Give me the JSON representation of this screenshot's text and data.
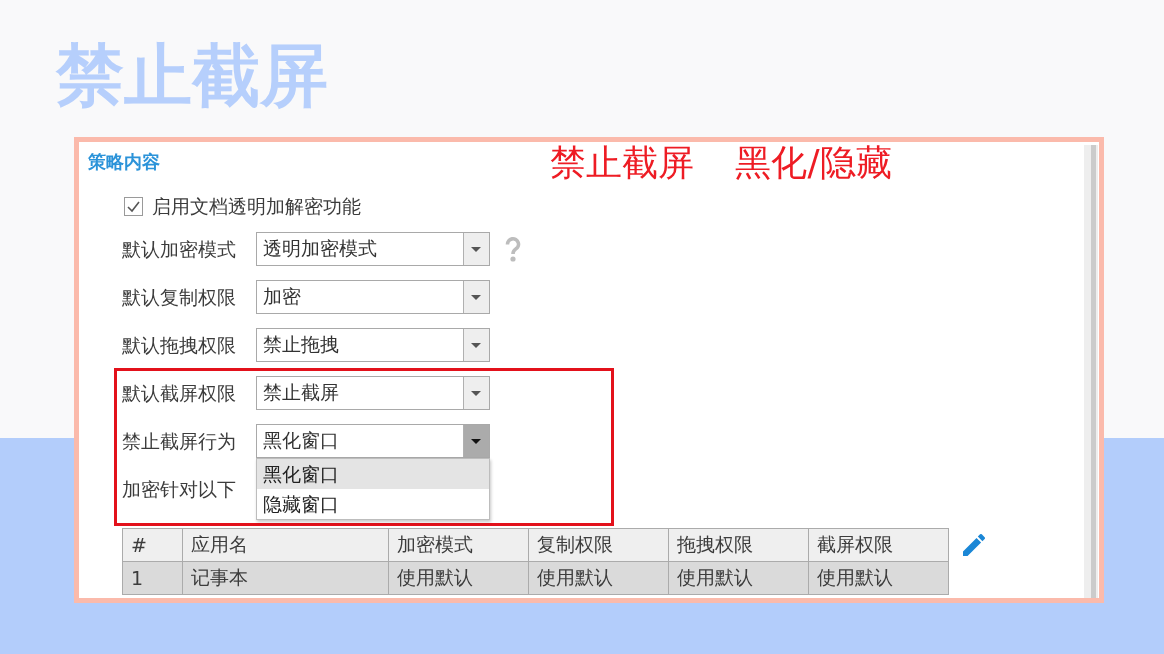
{
  "slide": {
    "title": "禁止截屏"
  },
  "screenshot": {
    "caption": "禁止截屏 黑化/隐藏",
    "section_title": "策略内容",
    "enable_option": {
      "label": "启用文档透明加解密功能",
      "checked": true
    },
    "settings": [
      {
        "label": "默认加密模式",
        "value": "透明加密模式",
        "open": false,
        "help": true
      },
      {
        "label": "默认复制权限",
        "value": "加密",
        "open": false,
        "help": false
      },
      {
        "label": "默认拖拽权限",
        "value": "禁止拖拽",
        "open": false,
        "help": false
      },
      {
        "label": "默认截屏权限",
        "value": "禁止截屏",
        "open": false,
        "help": false
      },
      {
        "label": "禁止截屏行为",
        "value": "黑化窗口",
        "open": true,
        "help": false,
        "options": [
          {
            "label": "黑化窗口",
            "selected": true
          },
          {
            "label": "隐藏窗口",
            "selected": false
          }
        ]
      }
    ],
    "apps_label": "加密针对以下",
    "table": {
      "columns": [
        "#",
        "应用名",
        "加密模式",
        "复制权限",
        "拖拽权限",
        "截屏权限"
      ],
      "rows": [
        {
          "cells": [
            "1",
            "记事本",
            "使用默认",
            "使用默认",
            "使用默认",
            "使用默认"
          ],
          "selected": true
        }
      ]
    }
  }
}
